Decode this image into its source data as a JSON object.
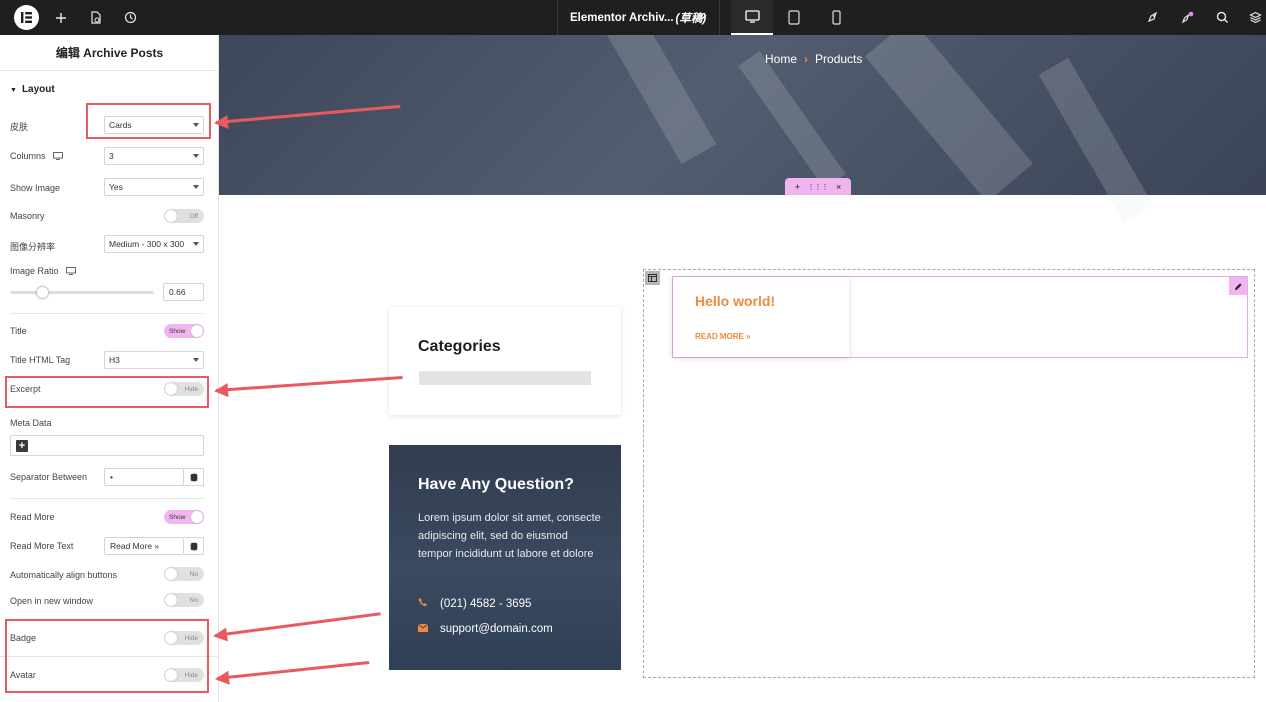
{
  "topbar": {
    "doc_title": "Elementor Archiv...",
    "doc_status": "(草稿)",
    "icons": [
      "elementor-logo-icon",
      "plus-icon",
      "structure-icon",
      "history-icon",
      "chevron-down-icon",
      "desktop-icon",
      "tablet-icon",
      "mobile-icon",
      "rocket-icon",
      "notifications-icon",
      "search-icon",
      "layers-icon"
    ]
  },
  "panel": {
    "title": "编辑 Archive Posts",
    "section": "Layout",
    "skin": {
      "label": "皮肤",
      "value": "Cards"
    },
    "columns": {
      "label": "Columns",
      "value": "3"
    },
    "show_image": {
      "label": "Show Image",
      "value": "Yes"
    },
    "masonry": {
      "label": "Masonry",
      "state": "Off"
    },
    "image_resolution": {
      "label": "图像分辨率",
      "value": "Medium - 300 x 300"
    },
    "image_ratio": {
      "label": "Image Ratio",
      "value": "0.66",
      "slider_fraction": 0.22
    },
    "title_toggle": {
      "label": "Title",
      "state": "Show"
    },
    "title_tag": {
      "label": "Title HTML Tag",
      "value": "H3"
    },
    "excerpt": {
      "label": "Excerpt",
      "state": "Hide"
    },
    "meta_data": {
      "label": "Meta Data",
      "add": "+"
    },
    "separator": {
      "label": "Separator Between",
      "value": "•"
    },
    "read_more": {
      "label": "Read More",
      "state": "Show"
    },
    "read_more_text": {
      "label": "Read More Text",
      "value": "Read More »"
    },
    "auto_align": {
      "label": "Automatically align buttons",
      "state": "No"
    },
    "new_window": {
      "label": "Open in new window",
      "state": "No"
    },
    "badge": {
      "label": "Badge",
      "state": "Hide"
    },
    "avatar": {
      "label": "Avatar",
      "state": "Hide"
    }
  },
  "canvas": {
    "breadcrumb": {
      "home": "Home",
      "sep": "›",
      "current": "Products"
    },
    "section_tab": {
      "add": "+",
      "move": "⋮⋮⋮",
      "close": "×"
    },
    "categories": {
      "title": "Categories"
    },
    "question": {
      "title": "Have Any Question?",
      "body": "Lorem ipsum dolor sit amet, consecte adipiscing elit, sed do eiusmod tempor incididunt ut labore et dolore",
      "phone": "(021) 4582 - 3695",
      "email": "support@domain.com"
    },
    "post": {
      "title": "Hello world!",
      "read_more": "READ MORE »"
    }
  },
  "colors": {
    "accent_orange": "#f1883b",
    "highlight_red": "#e85a5f",
    "handle_pink": "#f0b4ef",
    "topbar": "#1f1f1f"
  }
}
